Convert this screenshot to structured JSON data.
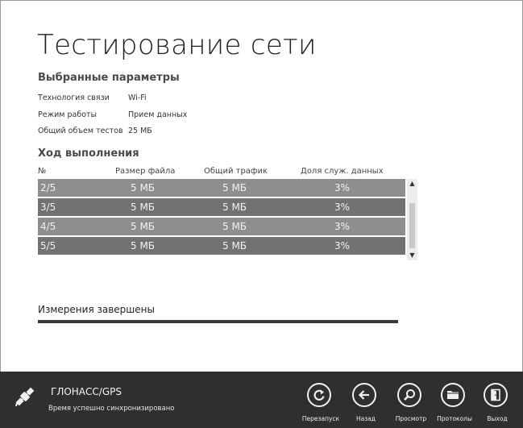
{
  "page": {
    "title": "Тестирование сети"
  },
  "params": {
    "heading": "Выбранные параметры",
    "rows": [
      {
        "label": "Технология связи",
        "value": "Wi-Fi"
      },
      {
        "label": "Режим работы",
        "value": "Прием данных"
      },
      {
        "label": "Общий объем тестов",
        "value": "25 МБ"
      }
    ]
  },
  "progress": {
    "heading": "Ход выполнения",
    "columns": [
      "№",
      "Размер файла",
      "Общий трафик",
      "Доля служ. данных"
    ],
    "rows": [
      {
        "num": "2/5",
        "size": "5 МБ",
        "traffic": "5 МБ",
        "share": "3%"
      },
      {
        "num": "3/5",
        "size": "5 МБ",
        "traffic": "5 МБ",
        "share": "3%"
      },
      {
        "num": "4/5",
        "size": "5 МБ",
        "traffic": "5 МБ",
        "share": "3%"
      },
      {
        "num": "5/5",
        "size": "5 МБ",
        "traffic": "5 МБ",
        "share": "3%"
      }
    ],
    "row_colors": [
      "#8e8e8e",
      "#727272",
      "#8e8e8e",
      "#727272"
    ],
    "status": "Измерения завершены",
    "fraction": 1.0
  },
  "appbar": {
    "background": "#2f2f2f",
    "gps_icon": "satellite-icon",
    "gps_title": "ГЛОНАСС/GPS",
    "gps_status": "Время успешно синхронизировано",
    "buttons": [
      {
        "name": "restart",
        "icon": "refresh-icon",
        "label": "Перезапуск"
      },
      {
        "name": "back",
        "icon": "arrow-left-icon",
        "label": "Назад"
      },
      {
        "name": "view",
        "icon": "magnifier-icon",
        "label": "Просмотр"
      },
      {
        "name": "protocols",
        "icon": "folder-icon",
        "label": "Протоколы"
      },
      {
        "name": "exit",
        "icon": "exit-door-icon",
        "label": "Выход"
      }
    ]
  }
}
